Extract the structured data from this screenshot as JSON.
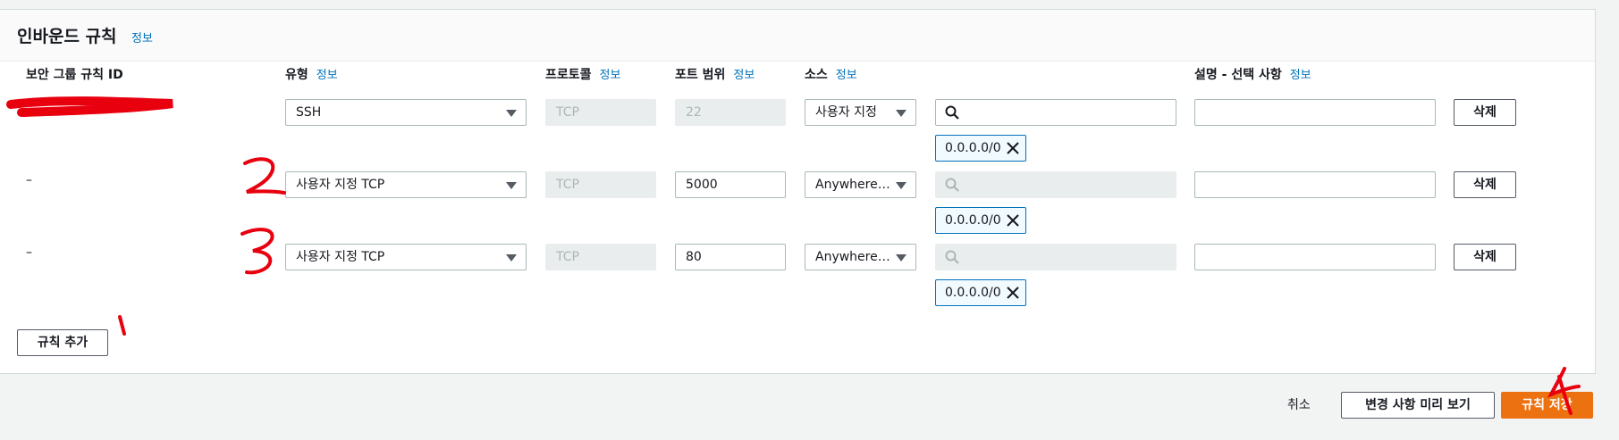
{
  "panel": {
    "title": "인바운드 규칙",
    "info": "정보"
  },
  "columns": {
    "rule_id": "보안 그룹 규칙 ID",
    "type": "유형",
    "protocol": "프로토콜",
    "port_range": "포트 범위",
    "source": "소스",
    "description": "설명 - 선택 사항",
    "info": "정보"
  },
  "rules": [
    {
      "id": "",
      "type": "SSH",
      "protocol": "TCP",
      "port": "22",
      "source": "사용자 지정",
      "cidr": "0.0.0.0/0",
      "delete": "삭제"
    },
    {
      "id": "–",
      "type": "사용자 지정 TCP",
      "protocol": "TCP",
      "port": "5000",
      "source": "Anywhere-I...",
      "cidr": "0.0.0.0/0",
      "delete": "삭제"
    },
    {
      "id": "–",
      "type": "사용자 지정 TCP",
      "protocol": "TCP",
      "port": "80",
      "source": "Anywhere-I...",
      "cidr": "0.0.0.0/0",
      "delete": "삭제"
    }
  ],
  "add_rule": "규칙 추가",
  "footer": {
    "cancel": "취소",
    "preview": "변경 사항 미리 보기",
    "save": "규칙 저장"
  },
  "colors": {
    "primary": "#ec7211",
    "link": "#0073bb",
    "annotation": "#e8000f"
  }
}
